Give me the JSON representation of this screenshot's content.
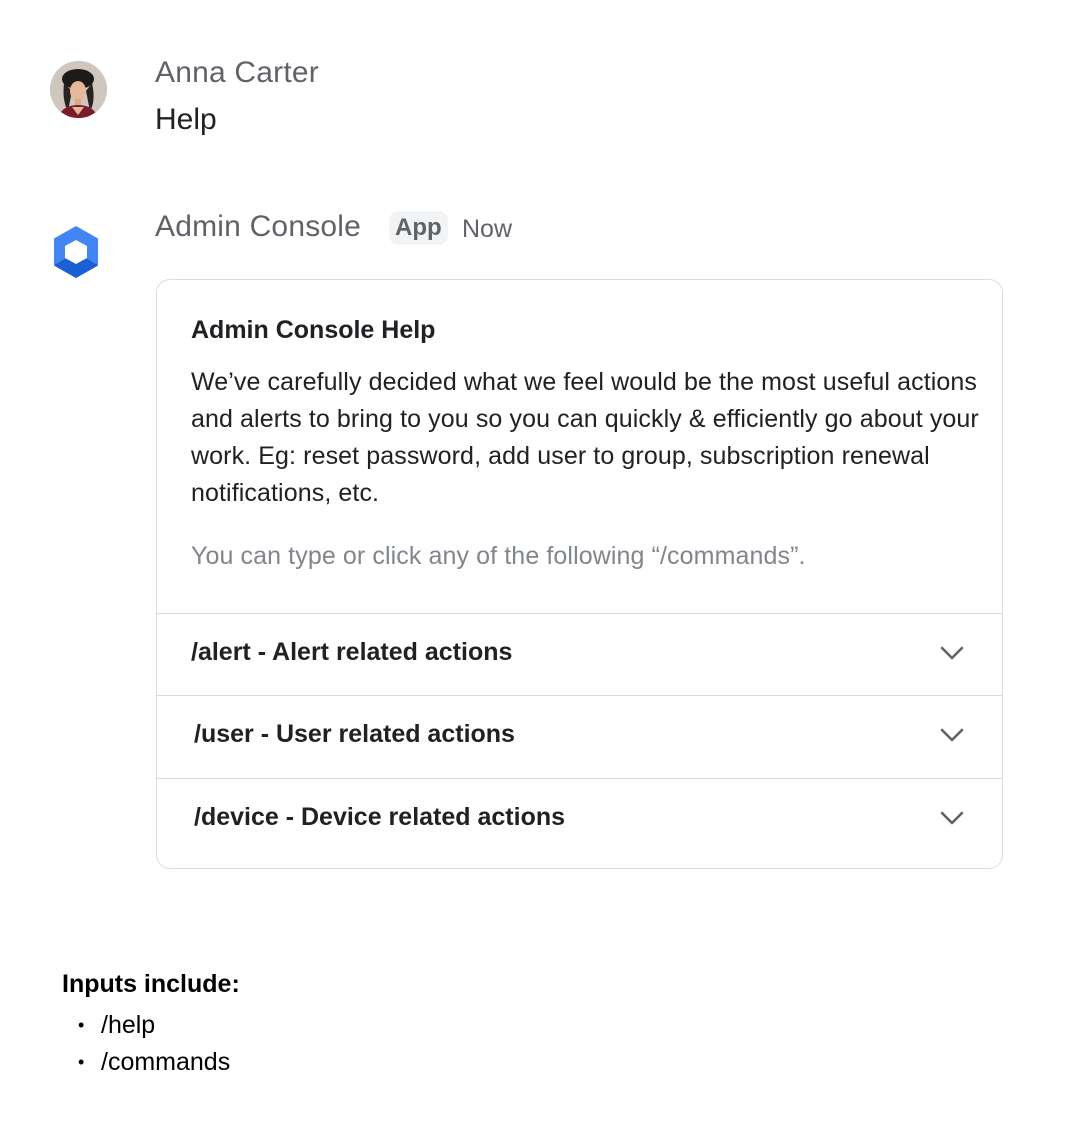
{
  "messages": {
    "user": {
      "sender": "Anna Carter",
      "text": "Help"
    },
    "app": {
      "sender": "Admin Console",
      "badge": "App",
      "timestamp": "Now",
      "card": {
        "title": "Admin Console Help",
        "body": "We’ve carefully decided what we feel would be the most useful actions and alerts to bring to you so you can quickly & efficiently go about your work. Eg: reset password, add user to group, subscription renewal notifications, etc.",
        "hint": "You can type or click any of the following “/commands”.",
        "commands": [
          {
            "label": "/alert - Alert related actions",
            "icon": "chevron-down-icon"
          },
          {
            "label": "/user - User related actions",
            "icon": "chevron-down-icon"
          },
          {
            "label": "/device - Device related actions",
            "icon": "chevron-down-icon"
          }
        ]
      }
    }
  },
  "notes": {
    "title": "Inputs include:",
    "items": [
      "/help",
      "/commands"
    ]
  },
  "colors": {
    "app_icon_primary": "#4285f4",
    "app_icon_dark": "#1a5fd6",
    "border": "#dadce0",
    "secondary_text": "#5f6368",
    "hint_text": "#80868b"
  }
}
